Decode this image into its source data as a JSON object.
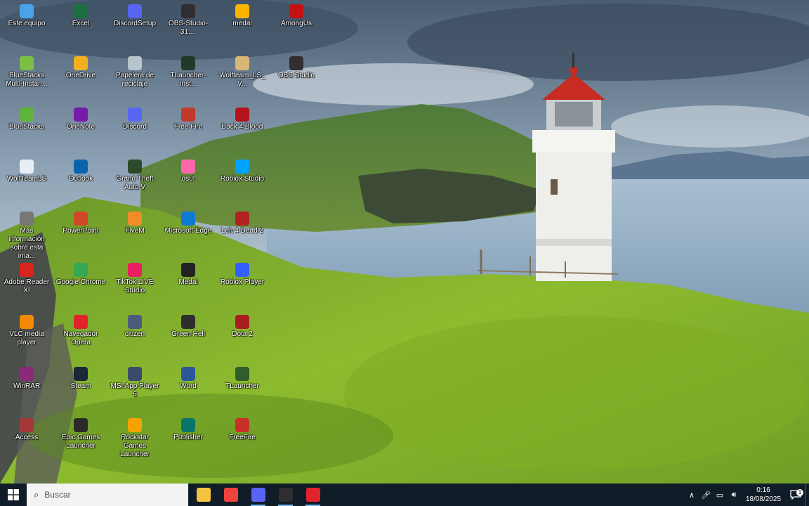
{
  "desktop": {
    "icons": [
      {
        "label": "Este equipo",
        "icon": "computer-icon",
        "color": "#4aa3e8"
      },
      {
        "label": "BlueStacks Multi-Instan...",
        "icon": "bluestacks-multi-icon",
        "color": "#7cc043"
      },
      {
        "label": "BlueStacks",
        "icon": "bluestacks-icon",
        "color": "#5fb33c"
      },
      {
        "label": "WolfTeamLS",
        "icon": "file-icon",
        "color": "#e8eef5"
      },
      {
        "label": "Más información sobre esta ima...",
        "icon": "camera-icon",
        "color": "#777777"
      },
      {
        "label": "Adobe Reader XI",
        "icon": "adobe-reader-icon",
        "color": "#d9231d"
      },
      {
        "label": "VLC media player",
        "icon": "vlc-icon",
        "color": "#f08a00"
      },
      {
        "label": "WinRAR",
        "icon": "winrar-icon",
        "color": "#8b2a7a"
      },
      {
        "label": "Access",
        "icon": "access-icon",
        "color": "#a4373a"
      },
      {
        "label": "Excel",
        "icon": "excel-icon",
        "color": "#1d6f42"
      },
      {
        "label": "OneDrive",
        "icon": "onedrive-icon",
        "color": "#f2b01e"
      },
      {
        "label": "OneNote",
        "icon": "onenote-icon",
        "color": "#7719aa"
      },
      {
        "label": "Outlook",
        "icon": "outlook-icon",
        "color": "#0a64ad"
      },
      {
        "label": "PowerPoint",
        "icon": "powerpoint-icon",
        "color": "#d24726"
      },
      {
        "label": "Google Chrome",
        "icon": "chrome-icon",
        "color": "#34a853"
      },
      {
        "label": "Navegador Opera",
        "icon": "opera-icon",
        "color": "#e1232c"
      },
      {
        "label": "Steam",
        "icon": "steam-icon",
        "color": "#1b2838"
      },
      {
        "label": "Epic Games Launcher",
        "icon": "epic-games-icon",
        "color": "#2a2a2a"
      },
      {
        "label": "DiscordSetup",
        "icon": "discord-setup-icon",
        "color": "#5865f2"
      },
      {
        "label": "Papelera de reciclaje",
        "icon": "recycle-bin-icon",
        "color": "#b8c4cc"
      },
      {
        "label": "Discord",
        "icon": "discord-icon",
        "color": "#5865f2"
      },
      {
        "label": "Grand Theft Auto V",
        "icon": "gta-icon",
        "color": "#2b4a2a"
      },
      {
        "label": "FiveM",
        "icon": "fivem-icon",
        "color": "#f28c28"
      },
      {
        "label": "TikTok LIVE Studio",
        "icon": "tiktok-icon",
        "color": "#e91e63"
      },
      {
        "label": "citizen",
        "icon": "folder-icon",
        "color": "#4b5b7a"
      },
      {
        "label": "MSI App Player 5",
        "icon": "msi-icon",
        "color": "#3a4a6a"
      },
      {
        "label": "Rockstar Games Launcher",
        "icon": "rockstar-icon",
        "color": "#f5a300"
      },
      {
        "label": "OBS-Studio-31....",
        "icon": "obs-setup-icon",
        "color": "#302e31"
      },
      {
        "label": "TLauncher-Inst...",
        "icon": "tlauncher-installer-icon",
        "color": "#1e3a2a"
      },
      {
        "label": "Free Fire",
        "icon": "freefire-icon",
        "color": "#c0392b"
      },
      {
        "label": "osu!",
        "icon": "osu-icon",
        "color": "#ff66aa"
      },
      {
        "label": "Microsoft Edge",
        "icon": "edge-icon",
        "color": "#0f7ad1"
      },
      {
        "label": "Medal",
        "icon": "medal-icon",
        "color": "#222222"
      },
      {
        "label": "Green Hell",
        "icon": "green-hell-icon",
        "color": "#2e2e2e"
      },
      {
        "label": "Word",
        "icon": "word-icon",
        "color": "#2b579a"
      },
      {
        "label": "Publisher",
        "icon": "publisher-icon",
        "color": "#077568"
      },
      {
        "label": "medal",
        "icon": "medal-setup-icon",
        "color": "#ffb400"
      },
      {
        "label": "Wolfteam_LS_V...",
        "icon": "archive-icon",
        "color": "#d8b776"
      },
      {
        "label": "Back 4 Blood",
        "icon": "back4blood-icon",
        "color": "#b3131b"
      },
      {
        "label": "Roblox Studio",
        "icon": "roblox-studio-icon",
        "color": "#00a2ff"
      },
      {
        "label": "Left 4 Dead 2",
        "icon": "left4dead-icon",
        "color": "#b22222"
      },
      {
        "label": "Roblox Player",
        "icon": "roblox-player-icon",
        "color": "#335fff"
      },
      {
        "label": "Dota 2",
        "icon": "dota-icon",
        "color": "#a81e1e"
      },
      {
        "label": "TLauncher",
        "icon": "tlauncher-icon",
        "color": "#2f5e2a"
      },
      {
        "label": "FreeFire",
        "icon": "freefire2-icon",
        "color": "#c9302c"
      },
      {
        "label": "AmongUs",
        "icon": "among-us-icon",
        "color": "#c51111"
      },
      {
        "label": "OBS Studio",
        "icon": "obs-icon",
        "color": "#302e31"
      }
    ]
  },
  "taskbar": {
    "search_placeholder": "Buscar",
    "apps": [
      {
        "name": "file-explorer",
        "icon": "folder-icon",
        "color": "#f5c242",
        "active": false
      },
      {
        "name": "anydesk",
        "icon": "anydesk-icon",
        "color": "#ef443b",
        "active": false
      },
      {
        "name": "discord",
        "icon": "discord-icon",
        "color": "#5865f2",
        "active": true
      },
      {
        "name": "obs-studio",
        "icon": "obs-icon",
        "color": "#302e31",
        "active": true
      },
      {
        "name": "opera",
        "icon": "opera-icon",
        "color": "#e1232c",
        "active": true
      }
    ],
    "clock_time": "0:16",
    "clock_date": "18/08/2025",
    "notification_count": "1"
  }
}
